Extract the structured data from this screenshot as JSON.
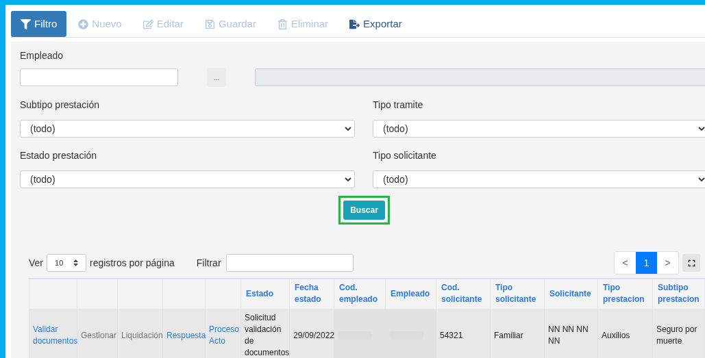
{
  "toolbar": [
    {
      "label": "Filtro",
      "kind": "primary",
      "disabled": false
    },
    {
      "label": "Nuevo",
      "kind": "plus",
      "disabled": true
    },
    {
      "label": "Editar",
      "kind": "edit",
      "disabled": true
    },
    {
      "label": "Guardar",
      "kind": "save",
      "disabled": true
    },
    {
      "label": "Eliminar",
      "kind": "trash",
      "disabled": true
    },
    {
      "label": "Exportar",
      "kind": "export",
      "disabled": false
    }
  ],
  "employee": {
    "label": "Empleado",
    "lookup_button": "..."
  },
  "selects": [
    {
      "label": "Subtipo prestación",
      "value": "(todo)"
    },
    {
      "label": "Tipo tramite",
      "value": "(todo)"
    },
    {
      "label": "Estado prestación",
      "value": "(todo)"
    },
    {
      "label": "Tipo solicitante",
      "value": "(todo)"
    }
  ],
  "search_button": {
    "label": "Buscar",
    "highlighted": true
  },
  "table_controls": {
    "show_label": "Ver",
    "page_size": "10",
    "per_page_label": "registros por página",
    "filter_label": "Filtrar"
  },
  "pagination": [
    {
      "label": "<",
      "selected": false
    },
    {
      "label": "1",
      "selected": true
    },
    {
      "label": ">",
      "selected": false
    }
  ],
  "table": {
    "columns": [
      "",
      "",
      "",
      "",
      "",
      "Estado",
      "Fecha estado",
      "Cod. empleado",
      "Empleado",
      "Cod. solicitante",
      "Tipo solicitante",
      "Solicitante",
      "Tipo prestacion",
      "Subtipo prestacion"
    ],
    "rows": [
      [
        {
          "text": "Validar documentos",
          "kind": "link"
        },
        {
          "text": "Gestionar",
          "kind": "muted"
        },
        {
          "text": "Liquidación",
          "kind": "muted"
        },
        {
          "text": "Respuesta",
          "kind": "link"
        },
        {
          "text": "Proceso Acto",
          "kind": "link"
        },
        {
          "text": "Solicitud validación de documentos",
          "kind": "text"
        },
        {
          "text": "29/09/2022",
          "kind": "text"
        },
        {
          "kind": "redacted"
        },
        {
          "kind": "redacted"
        },
        {
          "text": "54321",
          "kind": "text"
        },
        {
          "text": "Familiar",
          "kind": "text"
        },
        {
          "text": "NN NN NN NN",
          "kind": "text"
        },
        {
          "text": "Auxilios",
          "kind": "text"
        },
        {
          "text": "Seguro por muerte",
          "kind": "text"
        }
      ]
    ]
  }
}
